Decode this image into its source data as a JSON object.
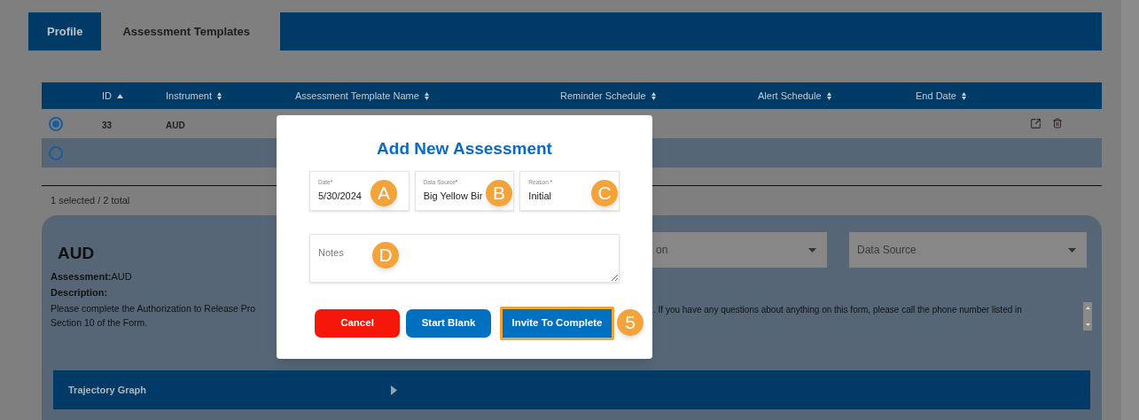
{
  "tabs": [
    {
      "label": "Profile",
      "selected": false
    },
    {
      "label": "Assessment Templates",
      "selected": true
    }
  ],
  "table": {
    "columns": [
      {
        "label": "ID",
        "sorted": true
      },
      {
        "label": "Instrument",
        "sorted": false
      },
      {
        "label": "Assessment Template Name",
        "sorted": false
      },
      {
        "label": "Reminder Schedule",
        "sorted": false
      },
      {
        "label": "Alert Schedule",
        "sorted": false
      },
      {
        "label": "End Date",
        "sorted": false
      }
    ],
    "rows": [
      {
        "selected": true,
        "id": "33",
        "instrument": "AUD",
        "actions": true
      },
      {
        "selected": false,
        "actions": false
      }
    ]
  },
  "status": "1 selected / 2 total",
  "detail": {
    "title": "AUD",
    "assessment": "**Assessment:**AUD",
    "description_label": "Description:",
    "description_left": [
      "Please complete the Authorization to Release Pro",
      "Section 10 of the Form."
    ],
    "description_right": ". If you have any questions about anything on this form, please call the phone number listed in",
    "dropdowns": [
      {
        "text": "on"
      },
      {
        "text": "Data Source"
      }
    ],
    "trajectory": "Trajectory Graph"
  },
  "modal": {
    "title": "Add New Assessment",
    "fields": [
      {
        "label": "Date",
        "required_mark": "*",
        "value": "5/30/2024"
      },
      {
        "label": "Data Source",
        "required_mark": "*",
        "value": "Big Yellow Bir"
      },
      {
        "label": "Reason ",
        "required_mark": "*",
        "value": "Initial"
      }
    ],
    "notes": {
      "placeholder": "Notes"
    },
    "buttons": [
      {
        "label": "Cancel",
        "kind": "danger",
        "highlighted": false
      },
      {
        "label": "Start Blank",
        "kind": "primary",
        "highlighted": false
      },
      {
        "label": "Invite To Complete",
        "kind": "primary",
        "highlighted": true
      }
    ]
  },
  "callouts": [
    "A",
    "B",
    "C",
    "D",
    "5"
  ]
}
